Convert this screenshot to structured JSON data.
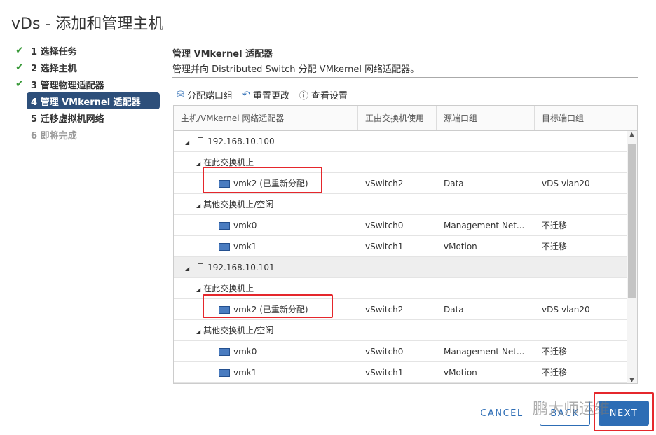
{
  "title": "vDs - 添加和管理主机",
  "steps": [
    {
      "label": "1 选择任务",
      "done": true
    },
    {
      "label": "2 选择主机",
      "done": true
    },
    {
      "label": "3 管理物理适配器",
      "done": true
    },
    {
      "label": "4 管理 VMkernel 适配器",
      "active": true
    },
    {
      "label": "5 迁移虚拟机网络"
    },
    {
      "label": "6 即将完成",
      "disabled": true
    }
  ],
  "section": {
    "title": "管理 VMkernel 适配器",
    "desc": "管理并向 Distributed Switch 分配 VMkernel 网络适配器。"
  },
  "toolbar": {
    "assign": "分配端口组",
    "reset": "重置更改",
    "view": "查看设置"
  },
  "columns": [
    "主机/VMkernel 网络适配器",
    "正由交换机使用",
    "源端口组",
    "目标端口组"
  ],
  "rows": [
    {
      "type": "host",
      "name": "192.168.10.100"
    },
    {
      "type": "group",
      "name": "在此交换机上"
    },
    {
      "type": "nic",
      "name": "vmk2 (已重新分配)",
      "sw": "vSwitch2",
      "src": "Data",
      "dst": "vDS-vlan20"
    },
    {
      "type": "group",
      "name": "其他交换机上/空闲"
    },
    {
      "type": "nic",
      "name": "vmk0",
      "sw": "vSwitch0",
      "src": "Management Net...",
      "dst": "不迁移"
    },
    {
      "type": "nic",
      "name": "vmk1",
      "sw": "vSwitch1",
      "src": "vMotion",
      "dst": "不迁移"
    },
    {
      "type": "host",
      "name": "192.168.10.101",
      "selected": true
    },
    {
      "type": "group",
      "name": "在此交换机上"
    },
    {
      "type": "nic",
      "name": "vmk2 (已重新分配)",
      "sw": "vSwitch2",
      "src": "Data",
      "dst": "vDS-vlan20"
    },
    {
      "type": "group",
      "name": "其他交换机上/空闲"
    },
    {
      "type": "nic",
      "name": "vmk0",
      "sw": "vSwitch0",
      "src": "Management Net...",
      "dst": "不迁移"
    },
    {
      "type": "nic",
      "name": "vmk1",
      "sw": "vSwitch1",
      "src": "vMotion",
      "dst": "不迁移"
    }
  ],
  "buttons": {
    "cancel": "CANCEL",
    "back": "BACK",
    "next": "NEXT"
  },
  "watermark": "鹏大师运维",
  "colors": {
    "accent": "#2d6db5",
    "active_step": "#2d4f7a",
    "highlight": "#e5272c"
  }
}
